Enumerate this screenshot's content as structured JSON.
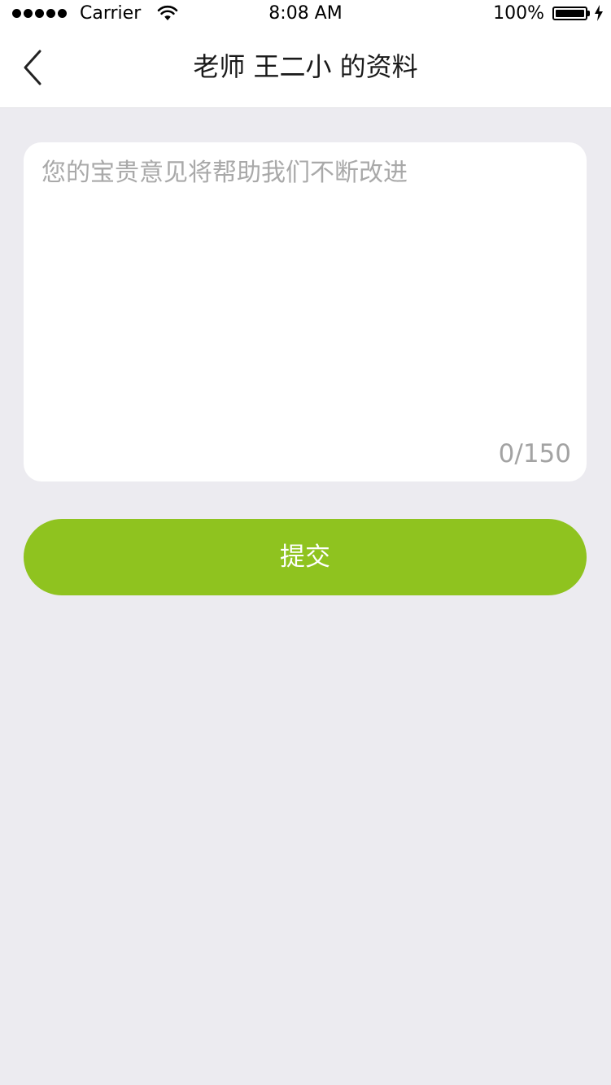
{
  "status_bar": {
    "carrier": "Carrier",
    "time": "8:08 AM",
    "battery": "100%",
    "icons": [
      "signal-dots-icon",
      "wifi-icon",
      "battery-icon",
      "charging-bolt-icon"
    ]
  },
  "nav": {
    "back_icon": "chevron-left-icon",
    "title": "老师 王二小 的资料"
  },
  "feedback": {
    "placeholder": "您的宝贵意见将帮助我们不断改进",
    "value": "",
    "counter": "0/150"
  },
  "submit": {
    "label": "提交"
  },
  "colors": {
    "accent": "#8fc31f",
    "background": "#ecebf0",
    "card": "#ffffff",
    "placeholder": "#a9a9a9"
  }
}
